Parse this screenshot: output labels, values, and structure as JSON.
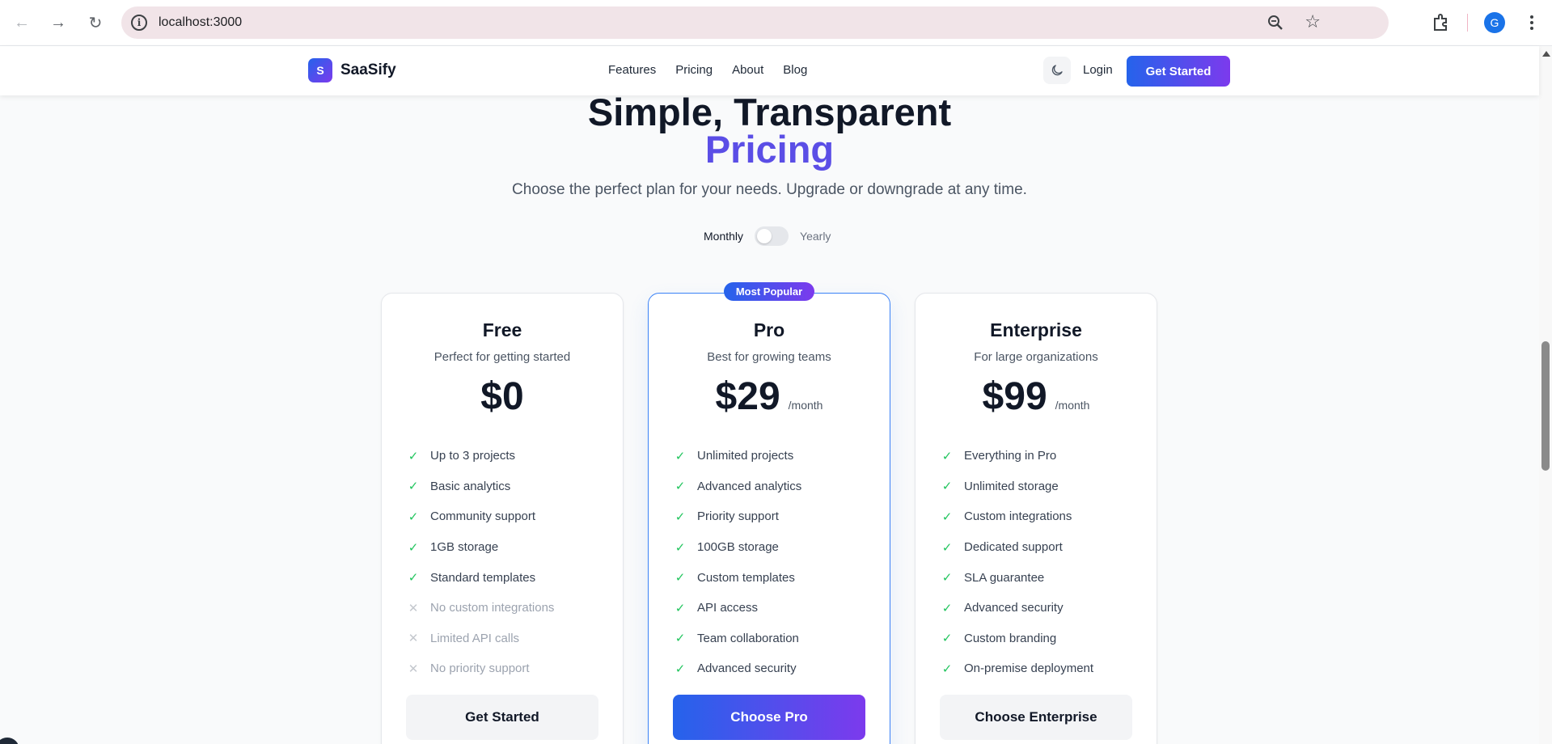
{
  "browser": {
    "url": "localhost:3000",
    "profile_initial": "G"
  },
  "header": {
    "logo_mark": "S",
    "logo_text": "SaaSify",
    "nav": [
      "Features",
      "Pricing",
      "About",
      "Blog"
    ],
    "login": "Login",
    "cta": "Get Started"
  },
  "hero": {
    "title_line1": "Simple, Transparent",
    "title_line2": "Pricing",
    "subtitle": "Choose the perfect plan for your needs. Upgrade or downgrade at any time."
  },
  "billing": {
    "monthly": "Monthly",
    "yearly": "Yearly"
  },
  "badge": "Most Popular",
  "plans": [
    {
      "name": "Free",
      "desc": "Perfect for getting started",
      "price": "$0",
      "period": "",
      "features": [
        {
          "text": "Up to 3 projects",
          "included": true
        },
        {
          "text": "Basic analytics",
          "included": true
        },
        {
          "text": "Community support",
          "included": true
        },
        {
          "text": "1GB storage",
          "included": true
        },
        {
          "text": "Standard templates",
          "included": true
        },
        {
          "text": "No custom integrations",
          "included": false
        },
        {
          "text": "Limited API calls",
          "included": false
        },
        {
          "text": "No priority support",
          "included": false
        }
      ],
      "action": "Get Started"
    },
    {
      "name": "Pro",
      "desc": "Best for growing teams",
      "price": "$29",
      "period": "/month",
      "features": [
        {
          "text": "Unlimited projects",
          "included": true
        },
        {
          "text": "Advanced analytics",
          "included": true
        },
        {
          "text": "Priority support",
          "included": true
        },
        {
          "text": "100GB storage",
          "included": true
        },
        {
          "text": "Custom templates",
          "included": true
        },
        {
          "text": "API access",
          "included": true
        },
        {
          "text": "Team collaboration",
          "included": true
        },
        {
          "text": "Advanced security",
          "included": true
        }
      ],
      "action": "Choose Pro"
    },
    {
      "name": "Enterprise",
      "desc": "For large organizations",
      "price": "$99",
      "period": "/month",
      "features": [
        {
          "text": "Everything in Pro",
          "included": true
        },
        {
          "text": "Unlimited storage",
          "included": true
        },
        {
          "text": "Custom integrations",
          "included": true
        },
        {
          "text": "Dedicated support",
          "included": true
        },
        {
          "text": "SLA guarantee",
          "included": true
        },
        {
          "text": "Advanced security",
          "included": true
        },
        {
          "text": "Custom branding",
          "included": true
        },
        {
          "text": "On-premise deployment",
          "included": true
        }
      ],
      "action": "Choose Enterprise"
    }
  ],
  "colors": {
    "accent_blue": "#2563eb",
    "accent_purple": "#7c3aed",
    "pricing_word": "#5b4ee6",
    "check": "#22c55e"
  }
}
